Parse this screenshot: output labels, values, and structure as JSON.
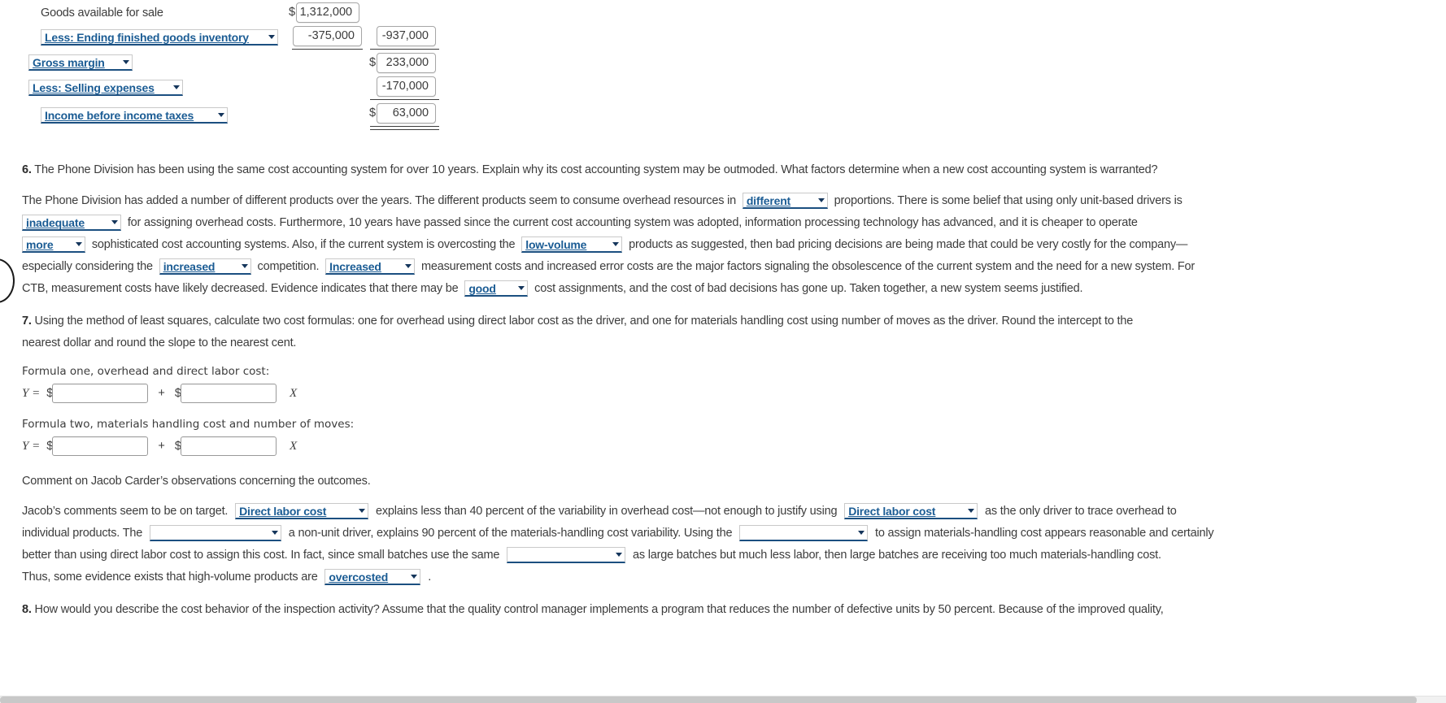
{
  "statement": {
    "rows": [
      {
        "label": "Goods available for sale",
        "label_kind": "text",
        "col1_dollar": "$",
        "col1_value": "1,312,000"
      },
      {
        "label": "Less: Ending finished goods inventory",
        "label_kind": "select",
        "col1_value": "-375,000",
        "col2_value": "-937,000"
      },
      {
        "label": "Gross margin",
        "label_kind": "select",
        "col2_dollar": "$",
        "col2_value": "233,000"
      },
      {
        "label": "Less: Selling expenses",
        "label_kind": "select",
        "col2_value": "-170,000"
      },
      {
        "label": "Income before income taxes",
        "label_kind": "select",
        "col2_dollar": "$",
        "col2_value": "63,000"
      }
    ]
  },
  "q6": {
    "number": "6.",
    "prompt": "The Phone Division has been using the same cost accounting system for over 10 years. Explain why its cost accounting system may be outmoded. What factors determine when a new cost accounting system is warranted?",
    "line1_a": "The Phone Division has added a number of different products over the years. The different products seem to consume overhead resources in",
    "sel1": "different",
    "line1_b": "proportions. There is some belief that using only unit-based drivers is",
    "sel2": "inadequate",
    "line2_b": "for assigning overhead costs. Furthermore, 10 years have passed since the current cost accounting system was adopted, information processing technology has advanced, and it is cheaper to operate",
    "sel3": "more",
    "line3_b": "sophisticated cost accounting systems. Also, if the current system is overcosting the",
    "sel4": "low-volume",
    "line3_c": "products as suggested, then bad pricing decisions are being made that could be very costly for the company—",
    "line4_a": "especially considering the",
    "sel5": "increased",
    "line4_b": "competition.",
    "sel6": "Increased",
    "line4_c": "measurement costs and increased error costs are the major factors signaling the obsolescence of the current system and the need for a new system. For",
    "line5_a": "CTB, measurement costs have likely decreased. Evidence indicates that there may be",
    "sel7": "good",
    "line5_b": "cost assignments, and the cost of bad decisions has gone up. Taken together, a new system seems justified."
  },
  "q7": {
    "number": "7.",
    "prompt_line1": "Using the method of least squares, calculate two cost formulas: one for overhead using direct labor cost as the driver, and one for materials handling cost using number of moves as the driver. Round the intercept to the",
    "prompt_line2": "nearest dollar and round the slope to the nearest cent.",
    "formula_one_label": "Formula one, overhead and direct labor cost:",
    "formula_two_label": "Formula two, materials handling cost and number of moves:",
    "y_eq": "Y =",
    "dollar": "$",
    "plus": "+",
    "x_var": "X",
    "formula_one_intercept": "",
    "formula_one_slope": "",
    "formula_two_intercept": "",
    "formula_two_slope": "",
    "comment_prompt": "Comment on Jacob Carder’s observations concerning the outcomes.",
    "ans_line1_a": "Jacob’s comments seem to be on target.",
    "sel1": "Direct labor cost",
    "ans_line1_b": "explains less than 40 percent of the variability in overhead cost—not enough to justify using",
    "sel2": "Direct labor cost",
    "ans_line1_c": "as the only driver to trace overhead to",
    "ans_line2_a": "individual products. The",
    "sel3": "",
    "ans_line2_b": "a non-unit driver, explains 90 percent of the materials-handling cost variability. Using the",
    "sel4": "",
    "ans_line2_c": "to assign materials-handling cost appears reasonable and certainly",
    "ans_line3_a": "better than using direct labor cost to assign this cost. In fact, since small batches use the same",
    "sel5": "",
    "ans_line3_b": "as large batches but much less labor, then large batches are receiving too much materials-handling cost.",
    "ans_line4_a": "Thus, some evidence exists that high-volume products are",
    "sel6": "overcosted",
    "ans_line4_b": "."
  },
  "q8": {
    "number": "8.",
    "prompt": "How would you describe the cost behavior of the inspection activity? Assume that the quality control manager implements a program that reduces the number of defective units by 50 percent. Because of the improved quality,"
  },
  "colors": {
    "select_text": "#1b5c94",
    "select_underline": "#1b4f80",
    "body_text": "#3c3c3c",
    "box_border": "#a6a6a6"
  }
}
